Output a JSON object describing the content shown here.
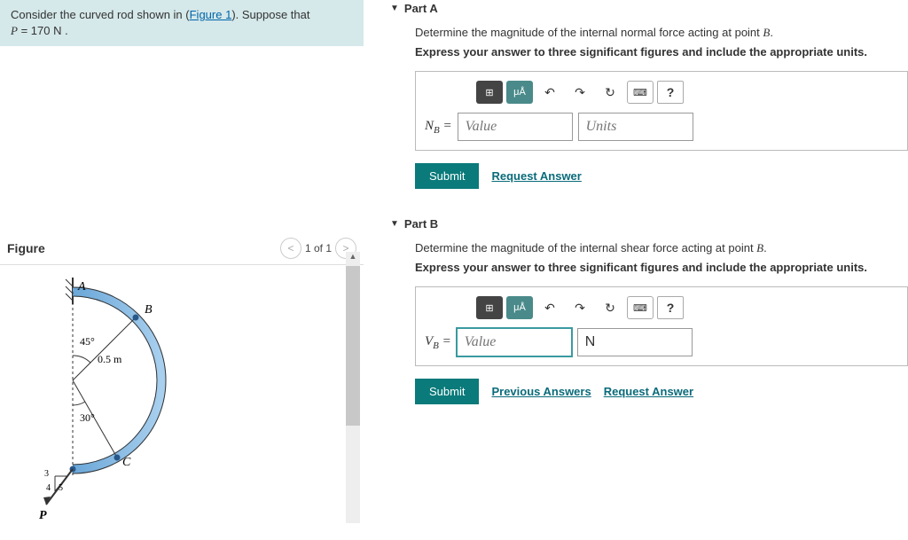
{
  "problem": {
    "prefix": "Consider the curved rod shown in (",
    "figure_link": "Figure 1",
    "suffix": "). Suppose that",
    "param_var": "P",
    "param_eq": " = 170  N .",
    "figure_title": "Figure",
    "pager_text": "1 of 1",
    "labels": {
      "A": "A",
      "B": "B",
      "C": "C",
      "P": "P",
      "angle1": "45°",
      "angle2": "30°",
      "radius": "0.5 m",
      "n3": "3",
      "n4": "4",
      "n5": "5"
    }
  },
  "partA": {
    "title": "Part A",
    "question_prefix": "Determine the magnitude of the internal normal force acting at point ",
    "question_point": "B",
    "question_suffix": ".",
    "instruction": "Express your answer to three significant figures and include the appropriate units.",
    "var": "N",
    "sub": "B",
    "value_ph": "Value",
    "units_ph": "Units",
    "submit": "Submit",
    "request": "Request Answer"
  },
  "partB": {
    "title": "Part B",
    "question_prefix": "Determine the magnitude of the internal shear force acting at point ",
    "question_point": "B",
    "question_suffix": ".",
    "instruction": "Express your answer to three significant figures and include the appropriate units.",
    "var": "V",
    "sub": "B",
    "value_ph": "Value",
    "units_value": "N",
    "submit": "Submit",
    "prev": "Previous Answers",
    "request": "Request Answer"
  },
  "tools": {
    "templates": "⊞",
    "mu": "μÅ",
    "undo": "↶",
    "redo": "↷",
    "reset": "↻",
    "keyboard": "⌨",
    "help": "?"
  }
}
